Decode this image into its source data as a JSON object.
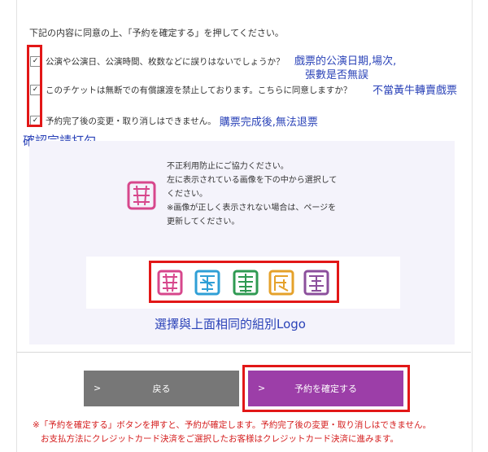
{
  "intro": "下記の内容に同意の上、「予約を確定する」を押してください。",
  "checks": [
    {
      "label": "公演や公演日、公演時間、枚数などに誤りはないでしょうか？",
      "checked": true,
      "annotation": "戲票的公演日期,場次,",
      "annotation2": "張數是否無誤"
    },
    {
      "label": "このチケットは無断での有償譲渡を禁止しております。こちらに同意しますか？",
      "checked": true,
      "annotation": "不當黃牛轉賣戲票"
    },
    {
      "label": "予約完了後の変更・取り消しはできません。",
      "checked": true,
      "annotation": "購票完成後,無法退票"
    }
  ],
  "check_mark": "✓",
  "confirm_annotation": "確認完請打勾",
  "captcha": {
    "instruction_lines": [
      "不正利用防止にご協力ください。",
      "左に表示されている画像を下の中から選択して",
      "ください。",
      "※画像が正しく表示されない場合は、ページを",
      "更新してください。"
    ],
    "annotation": "選擇與上面相同的組別Logo",
    "option_colors": [
      "#d7478c",
      "#2f9fd6",
      "#2f9a52",
      "#e5a12a",
      "#8b4f9c"
    ]
  },
  "buttons": {
    "back": "戻る",
    "confirm": "予約を確定する",
    "chevron": ">"
  },
  "notice": [
    "※「予約を確定する」ボタンを押すと、予約が確定します。予約完了後の変更・取り消しはできません。",
    "お支払方法にクレジットカード決済をご選択したお客様はクレジットカード決済に進みます。"
  ],
  "colors": {
    "annotation": "#2b43b8",
    "highlight": "#e21717",
    "confirm": "#9c3ea8",
    "back": "#777777",
    "notice": "#d41c1c"
  }
}
